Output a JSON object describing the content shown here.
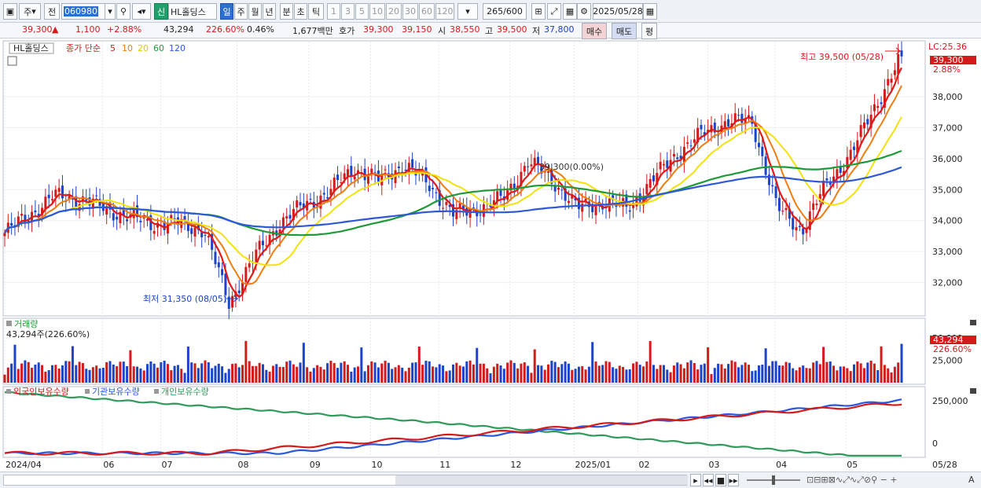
{
  "toolbar": {
    "market": "주",
    "prev": "전",
    "code": "060980",
    "new_badge": "신",
    "name": "HL홀딩스",
    "periods": [
      "일",
      "주",
      "월",
      "년",
      "분",
      "초",
      "틱"
    ],
    "minutes": [
      "1",
      "3",
      "5",
      "10",
      "20",
      "30",
      "60",
      "120"
    ],
    "count": "265",
    "count_max": "/600",
    "date": "2025/05/28"
  },
  "quote": {
    "price": "39,300",
    "arrow": "▲",
    "change": "1,100",
    "change_pct": "+2.88%",
    "volume": "43,294",
    "volume_ratio": "226.60%",
    "turnover": "0.46%",
    "amount": "1,677백만",
    "hoga_label": "호가",
    "ask": "39,300",
    "bid": "39,150",
    "open_label": "시",
    "open": "38,550",
    "high_label": "고",
    "high": "39,500",
    "low_label": "저",
    "low": "37,800",
    "buy_btn": "매수",
    "sell_btn": "매도",
    "eval_btn": "평"
  },
  "price_panel": {
    "legend_name": "HL홀딩스",
    "legend_close": "종가 단순",
    "ma_labels": [
      "5",
      "10",
      "20",
      "60",
      "120"
    ],
    "lc_label": "LC:25.36",
    "last_price_tag": "39,300",
    "change_tag": "2.88%",
    "high_annot": "최고 39,500 (05/28)",
    "low_annot": "최저 31,350 (08/05)",
    "cross_annot": "39,300(0.00%)",
    "y_ticks": [
      "38,000",
      "37,000",
      "36,000",
      "35,000",
      "34,000",
      "33,000",
      "32,000"
    ]
  },
  "volume_panel": {
    "title": "거래량",
    "current": "43,294주(226.60%)",
    "y_ticks": [
      "50,000",
      "25,000"
    ],
    "tag_value": "43,294",
    "tag_pct": "226.60%"
  },
  "holder_panel": {
    "legend": [
      "외국인보유수량",
      "기관보유수량",
      "개인보유수량"
    ],
    "y_ticks": [
      "250,000",
      "0"
    ]
  },
  "x_axis": {
    "labels": [
      "2024/04",
      "06",
      "07",
      "08",
      "09",
      "10",
      "11",
      "12",
      "2025/01",
      "02",
      "03",
      "04",
      "05"
    ],
    "right_label": "05/28"
  },
  "colors": {
    "up": "#d41b1b",
    "down": "#1c44c8",
    "ma5": "#e01818",
    "ma10": "#f07d10",
    "ma20": "#f2e20c",
    "ma60": "#1f9a38",
    "ma120": "#2f58d8",
    "foreign": "#d41b1b",
    "institution": "#2a56e0",
    "individual": "#2f9a5a"
  },
  "chart_data": {
    "type": "candlestick",
    "title": "HL홀딩스",
    "x": [
      "2024/04",
      "06",
      "07",
      "08",
      "09",
      "10",
      "11",
      "12",
      "2025/01",
      "02",
      "03",
      "04",
      "05"
    ],
    "ylim": [
      31000,
      39600
    ],
    "close_series": [
      {
        "date": "2024/04",
        "close": 33600
      },
      {
        "date": "2024/05-early",
        "close": 34200
      },
      {
        "date": "2024/05-mid",
        "close": 34800
      },
      {
        "date": "2024/05-late",
        "close": 34700
      },
      {
        "date": "2024/06",
        "close": 34400
      },
      {
        "date": "2024/06-mid",
        "close": 34100
      },
      {
        "date": "2024/07",
        "close": 33900
      },
      {
        "date": "2024/07-mid",
        "close": 33900
      },
      {
        "date": "2024/07-late",
        "close": 33700
      },
      {
        "date": "2024/08/05",
        "close": 31350
      },
      {
        "date": "2024/08-mid",
        "close": 32800
      },
      {
        "date": "2024/08-late",
        "close": 33900
      },
      {
        "date": "2024/09",
        "close": 34500
      },
      {
        "date": "2024/09-mid",
        "close": 34900
      },
      {
        "date": "2024/10",
        "close": 35700
      },
      {
        "date": "2024/10-mid",
        "close": 35300
      },
      {
        "date": "2024/10-late",
        "close": 35800
      },
      {
        "date": "2024/11",
        "close": 35200
      },
      {
        "date": "2024/11-mid",
        "close": 34200
      },
      {
        "date": "2024/11-late",
        "close": 34400
      },
      {
        "date": "2024/12",
        "close": 34700
      },
      {
        "date": "2024/12-mid",
        "close": 35900
      },
      {
        "date": "2024/12-late",
        "close": 35300
      },
      {
        "date": "2025/01",
        "close": 34400
      },
      {
        "date": "2025/01-mid",
        "close": 34600
      },
      {
        "date": "2025/02",
        "close": 34400
      },
      {
        "date": "2025/02-mid",
        "close": 35300
      },
      {
        "date": "2025/02-late",
        "close": 36200
      },
      {
        "date": "2025/03",
        "close": 36800
      },
      {
        "date": "2025/03-mid",
        "close": 37200
      },
      {
        "date": "2025/03-late",
        "close": 37200
      },
      {
        "date": "2025/04",
        "close": 34400
      },
      {
        "date": "2025/04-mid",
        "close": 33700
      },
      {
        "date": "2025/04-late",
        "close": 35200
      },
      {
        "date": "2025/05",
        "close": 36200
      },
      {
        "date": "2025/05-mid",
        "close": 37800
      },
      {
        "date": "2025/05/28",
        "close": 39300
      }
    ],
    "annotations": {
      "high": 39500,
      "high_date": "05/28",
      "low": 31350,
      "low_date": "08/05"
    },
    "volume_last": 43294,
    "holder_ylim": [
      -80000,
      320000
    ]
  }
}
